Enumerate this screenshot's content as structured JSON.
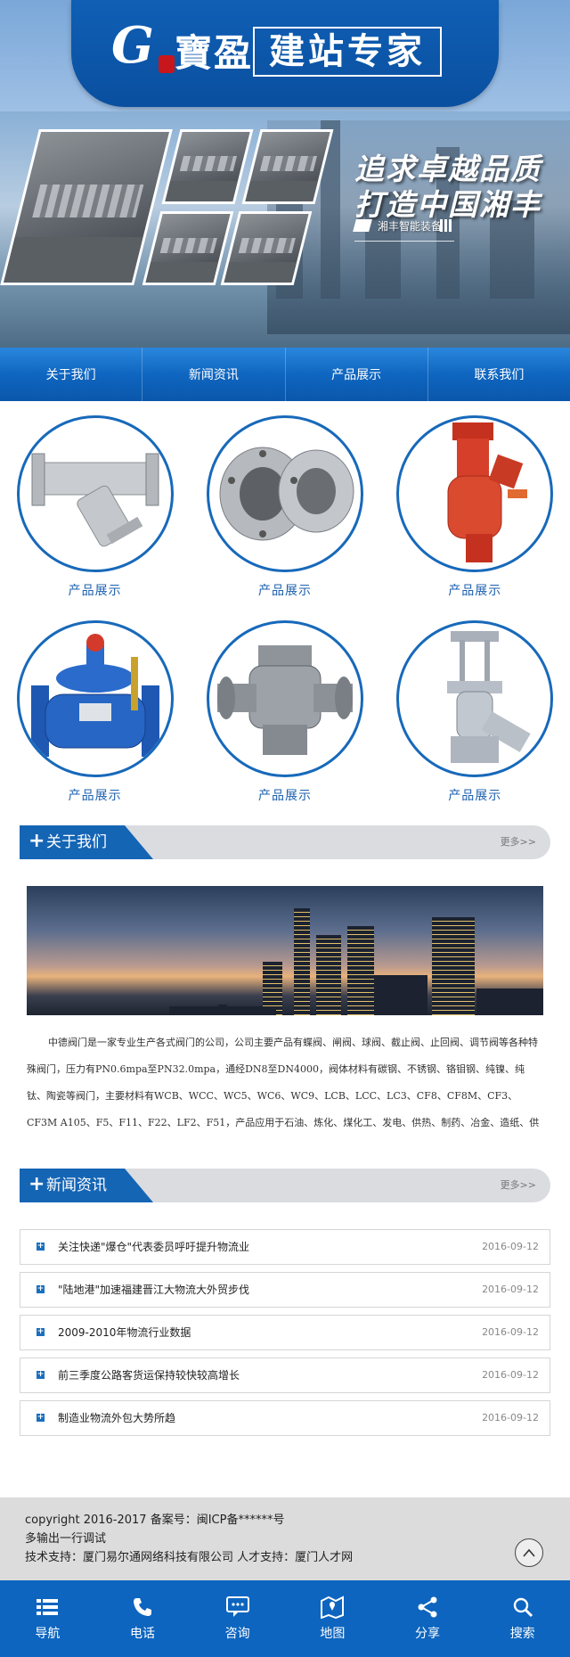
{
  "header": {
    "logo_letter": "G",
    "logo_name": "寶盈",
    "slogan": "建站专家"
  },
  "banner": {
    "line1": "追求卓越品质",
    "line2": "打造中国湘丰",
    "tag": "湘丰智能装备"
  },
  "nav": {
    "items": [
      {
        "label": "关于我们"
      },
      {
        "label": "新闻资讯"
      },
      {
        "label": "产品展示"
      },
      {
        "label": "联系我们"
      }
    ]
  },
  "products": {
    "items": [
      {
        "label": "产品展示",
        "icon": "y-strainer-valve"
      },
      {
        "label": "产品展示",
        "icon": "flange-pipes"
      },
      {
        "label": "产品展示",
        "icon": "red-filter-valve"
      },
      {
        "label": "产品展示",
        "icon": "blue-control-valve"
      },
      {
        "label": "产品展示",
        "icon": "four-way-valve"
      },
      {
        "label": "产品展示",
        "icon": "angle-valve"
      }
    ]
  },
  "about": {
    "title": "关于我们",
    "more": "更多>>",
    "text": "中德阀门是一家专业生产各式阀门的公司，公司主要产品有蝶阀、闸阀、球阀、截止阀、止回阀、调节阀等各种特殊阀门，压力有PN0.6mpa至PN32.0mpa，通经DN8至DN4000，阀体材料有碳钢、不锈钢、铬钼钢、纯镍、纯钛、陶瓷等阀门，主要材料有WCB、WCC、WC5、WC6、WC9、LCB、LCC、LC3、CF8、CF8M、CF3、CF3M A105、F5、F11、F22、LF2、F51，产品应用于石油、炼化、煤化工、发电、供热、制药、冶金、造纸、供排"
  },
  "news": {
    "title": "新闻资讯",
    "more": "更多>>",
    "items": [
      {
        "title": "关注快递\"爆仓\"代表委员呼吁提升物流业",
        "date": "2016-09-12"
      },
      {
        "title": "\"陆地港\"加速福建晋江大物流大外贸步伐",
        "date": "2016-09-12"
      },
      {
        "title": "2009-2010年物流行业数据",
        "date": "2016-09-12"
      },
      {
        "title": "前三季度公路客货运保持较快较高增长",
        "date": "2016-09-12"
      },
      {
        "title": "制造业物流外包大势所趋",
        "date": "2016-09-12"
      }
    ]
  },
  "footer": {
    "line1": "copyright 2016-2017 备案号：闽ICP备******号",
    "line2": "多输出一行调试",
    "line3": "技术支持：厦门易尔通网络科技有限公司 人才支持：厦门人才网"
  },
  "bottom_bar": {
    "items": [
      {
        "label": "导航",
        "icon": "menu-icon"
      },
      {
        "label": "电话",
        "icon": "phone-icon"
      },
      {
        "label": "咨询",
        "icon": "chat-icon"
      },
      {
        "label": "地图",
        "icon": "map-icon"
      },
      {
        "label": "分享",
        "icon": "share-icon"
      },
      {
        "label": "搜索",
        "icon": "search-icon"
      }
    ]
  },
  "colors": {
    "primary": "#0d65bf",
    "product_label": "#1b5fad",
    "section_gray": "#dadce0"
  }
}
